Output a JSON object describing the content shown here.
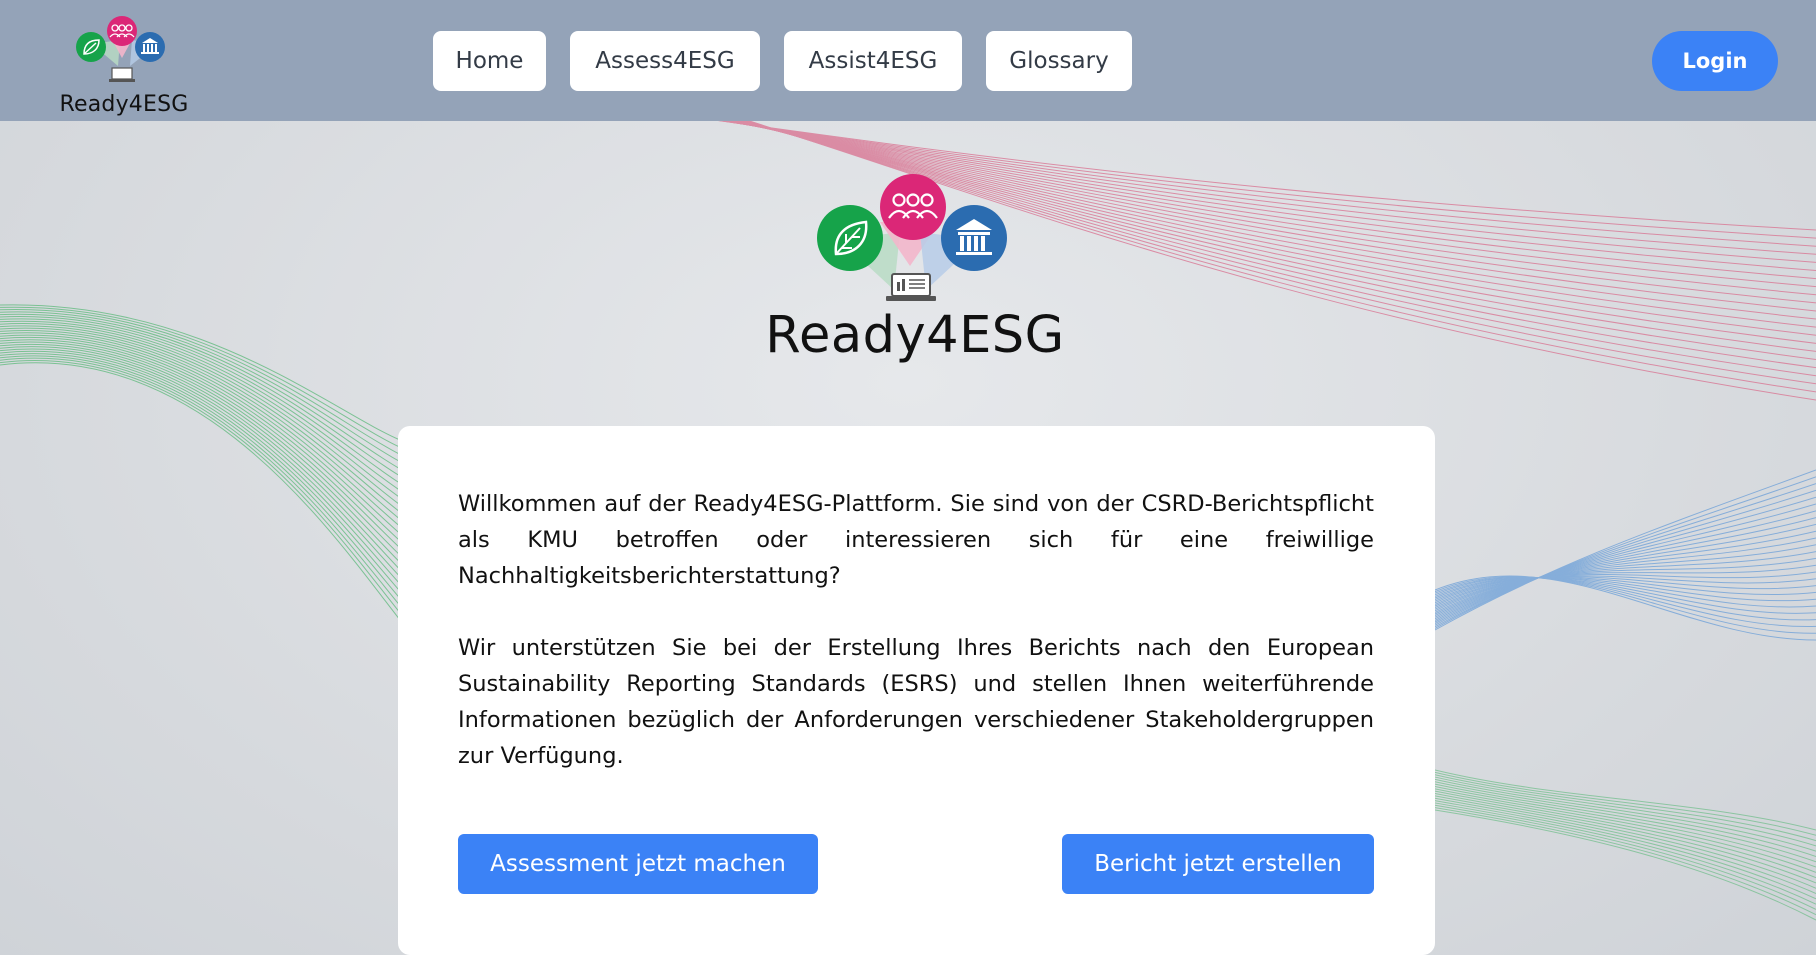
{
  "brand": {
    "name": "Ready4ESG"
  },
  "nav": {
    "items": [
      {
        "label": "Home"
      },
      {
        "label": "Assess4ESG"
      },
      {
        "label": "Assist4ESG"
      },
      {
        "label": "Glossary"
      }
    ],
    "login_label": "Login"
  },
  "hero": {
    "title": "Ready4ESG"
  },
  "card": {
    "paragraphs": [
      "Willkommen auf der Ready4ESG-Plattform. Sie sind von der CSRD-Berichtspflicht als KMU betroffen oder interessieren sich für eine freiwillige Nachhaltigkeitsberichterstattung?",
      "Wir unterstützen Sie bei der Erstellung Ihres Berichts nach den European Sustainability Reporting Standards (ESRS) und stellen Ihnen weiterführende Informationen bezüglich der Anforderungen verschiedener Stakeholdergruppen zur Verfügung."
    ],
    "primary_cta": "Assessment jetzt machen",
    "secondary_cta": "Bericht jetzt erstellen"
  },
  "icons": {
    "environment": "leaf-icon",
    "social": "people-icon",
    "governance": "bank-icon",
    "report": "laptop-icon"
  },
  "colors": {
    "header_bg": "#94a3b8",
    "accent": "#3b82f6",
    "environment": "#16a34a",
    "social": "#db2777",
    "governance": "#2b6cb0",
    "wave_green": "#5cb97a",
    "wave_pink": "#d9708f",
    "wave_blue": "#6b9fd8"
  }
}
